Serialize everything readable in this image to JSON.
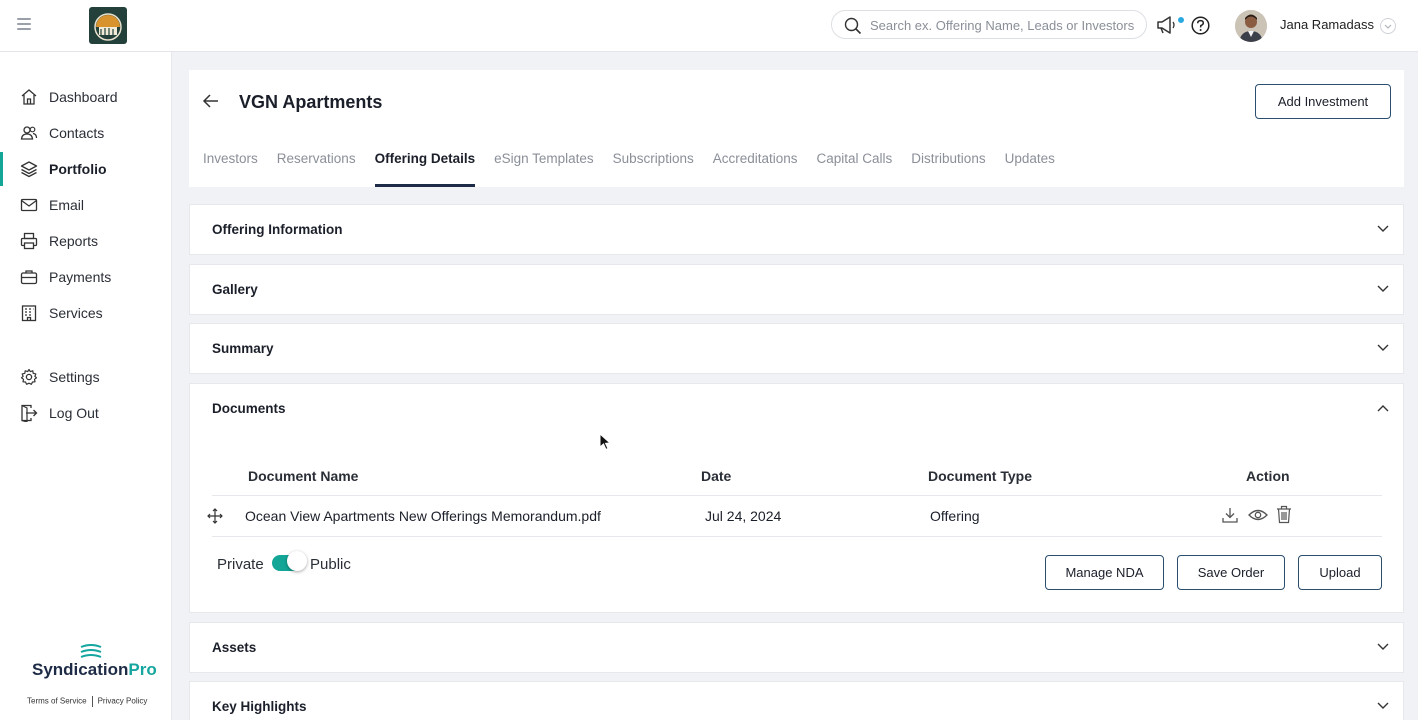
{
  "topbar": {
    "search_placeholder": "Search ex. Offering Name, Leads or Investors",
    "user_name": "Jana Ramadass"
  },
  "sidebar": {
    "items": [
      {
        "label": "Dashboard",
        "icon": "home-icon"
      },
      {
        "label": "Contacts",
        "icon": "contacts-icon"
      },
      {
        "label": "Portfolio",
        "icon": "layers-icon",
        "active": true
      },
      {
        "label": "Email",
        "icon": "mail-icon"
      },
      {
        "label": "Reports",
        "icon": "printer-icon"
      },
      {
        "label": "Payments",
        "icon": "briefcase-icon"
      },
      {
        "label": "Services",
        "icon": "building-icon"
      },
      {
        "label": "Settings",
        "icon": "gear-icon"
      },
      {
        "label": "Log Out",
        "icon": "logout-icon"
      }
    ],
    "brand_main": "Syndication",
    "brand_accent": "Pro",
    "terms": "Terms of Service",
    "privacy": "Privacy Policy"
  },
  "header": {
    "title": "VGN Apartments",
    "add_investment": "Add Investment",
    "tabs": [
      "Investors",
      "Reservations",
      "Offering Details",
      "eSign Templates",
      "Subscriptions",
      "Accreditations",
      "Capital Calls",
      "Distributions",
      "Updates"
    ],
    "active_tab": "Offering Details"
  },
  "sections": {
    "offering_information": "Offering Information",
    "gallery": "Gallery",
    "summary": "Summary",
    "documents": "Documents",
    "assets": "Assets",
    "key_highlights": "Key Highlights"
  },
  "documents": {
    "columns": {
      "name": "Document Name",
      "date": "Date",
      "type": "Document Type",
      "action": "Action"
    },
    "rows": [
      {
        "name": "Ocean View Apartments New Offerings Memorandum.pdf",
        "date": "Jul 24, 2024",
        "type": "Offering"
      }
    ],
    "private_label": "Private",
    "public_label": "Public",
    "visibility_public": true,
    "manage_nda": "Manage NDA",
    "save_order": "Save Order",
    "upload": "Upload"
  },
  "colors": {
    "accent": "#13a596",
    "brand_navy": "#1d2b46",
    "notification_dot": "#2aa9e0"
  }
}
